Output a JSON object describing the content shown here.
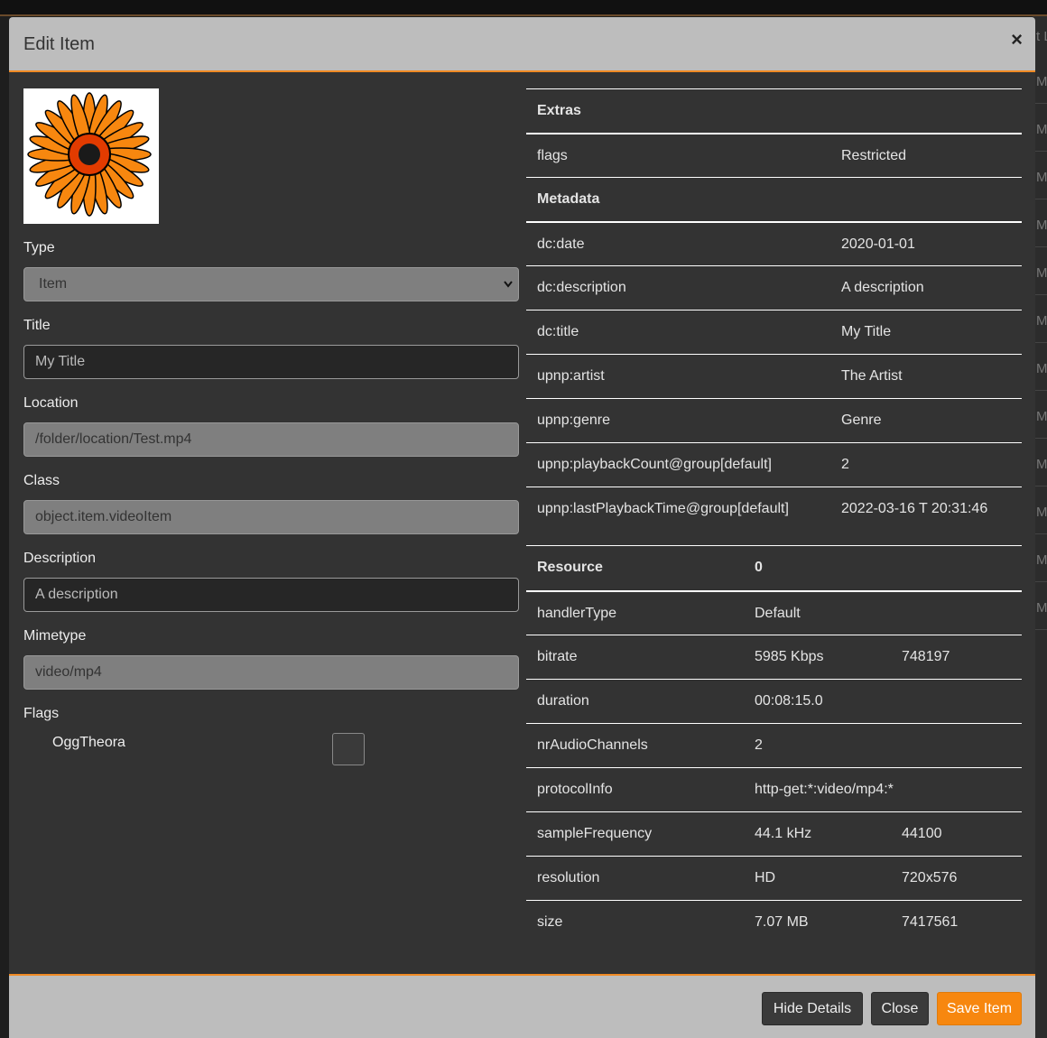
{
  "modal": {
    "title": "Edit Item",
    "close_symbol": "×"
  },
  "form": {
    "type_label": "Type",
    "type_value": "Item",
    "title_label": "Title",
    "title_value": "My Title",
    "location_label": "Location",
    "location_value": "/folder/location/Test.mp4",
    "class_label": "Class",
    "class_value": "object.item.videoItem",
    "description_label": "Description",
    "description_value": "A description",
    "mimetype_label": "Mimetype",
    "mimetype_value": "video/mp4",
    "flags_label": "Flags",
    "flag_option": "OggTheora",
    "flag_checked": false
  },
  "details": {
    "extras_heading": "Extras",
    "flags_key": "flags",
    "flags_value": "Restricted",
    "metadata_heading": "Metadata",
    "metadata": [
      {
        "key": "dc:date",
        "value": "2020-01-01"
      },
      {
        "key": "dc:description",
        "value": "A description"
      },
      {
        "key": "dc:title",
        "value": "My Title"
      },
      {
        "key": "upnp:artist",
        "value": "The Artist"
      },
      {
        "key": "upnp:genre",
        "value": "Genre"
      },
      {
        "key": "upnp:playbackCount@group[default]",
        "value": "2"
      },
      {
        "key": "upnp:lastPlaybackTime@group[default]",
        "value": "2022-03-16 T 20:31:46"
      }
    ],
    "resource_heading": "Resource",
    "resource_index": "0",
    "resource": [
      {
        "key": "handlerType",
        "value": "Default",
        "raw": ""
      },
      {
        "key": "bitrate",
        "value": "5985 Kbps",
        "raw": "748197"
      },
      {
        "key": "duration",
        "value": "00:08:15.0",
        "raw": ""
      },
      {
        "key": "nrAudioChannels",
        "value": "2",
        "raw": ""
      },
      {
        "key": "protocolInfo",
        "value": "http-get:*:video/mp4:*",
        "raw": ""
      },
      {
        "key": "sampleFrequency",
        "value": "44.1 kHz",
        "raw": "44100"
      },
      {
        "key": "resolution",
        "value": "HD",
        "raw": "720x576"
      },
      {
        "key": "size",
        "value": "7.07 MB",
        "raw": "7417561"
      }
    ]
  },
  "footer": {
    "hide_details": "Hide Details",
    "close": "Close",
    "save": "Save Item"
  },
  "background": {
    "fragments": [
      "t L",
      "M",
      "M",
      "M",
      "M",
      "M",
      "M",
      "M",
      "M",
      "M",
      "M",
      "M",
      "M",
      "M"
    ]
  },
  "colors": {
    "accent": "#f7870f",
    "modal_bg": "#333333",
    "header_bg": "#bdbdbd"
  }
}
